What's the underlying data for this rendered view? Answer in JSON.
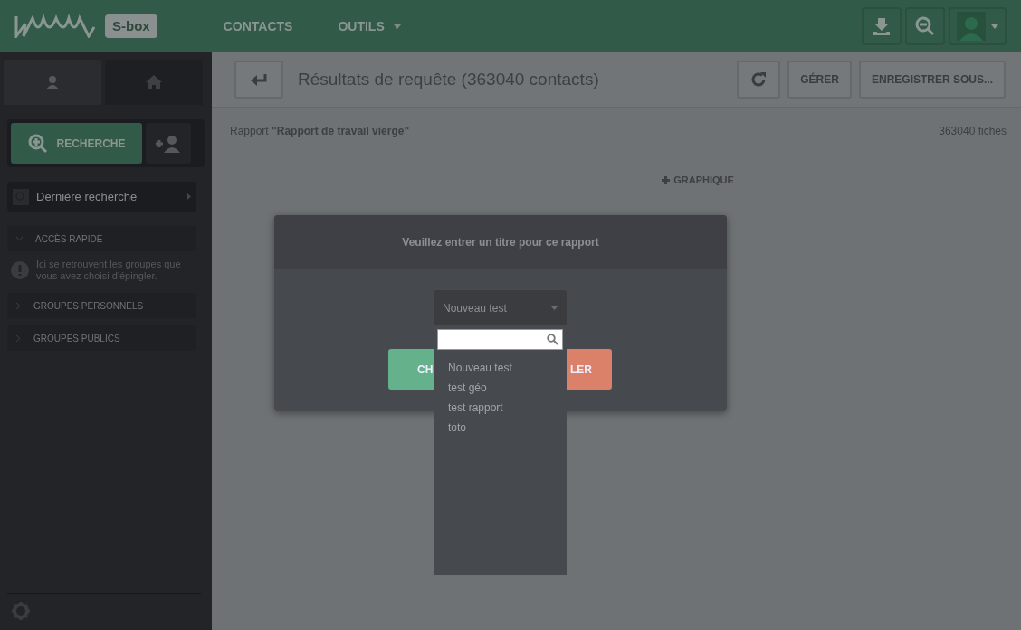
{
  "navbar": {
    "badge": "S-box",
    "items": [
      {
        "label": "CONTACTS",
        "dropdown": false
      },
      {
        "label": "OUTILS",
        "dropdown": true
      }
    ]
  },
  "sidebar": {
    "tabs": [
      {
        "kind": "contacts",
        "selected": true
      },
      {
        "kind": "home",
        "selected": false
      }
    ],
    "search_button": "RECHERCHE",
    "last_search": "Dernière recherche",
    "sections": [
      {
        "label": "ACCÈS RAPIDE",
        "expanded": true,
        "note": "Ici se retrouvent les groupes que vous avez choisi d'épingler."
      },
      {
        "label": "GROUPES PERSONNELS",
        "expanded": false
      },
      {
        "label": "GROUPES PUBLICS",
        "expanded": false
      }
    ]
  },
  "toolbar": {
    "title": "Résultats de requête (363040 contacts)",
    "buttons": [
      "GÉRER",
      "ENREGISTRER SOUS..."
    ]
  },
  "report": {
    "label": "Rapport **\"Rapport de travail vierge\"**",
    "count": "363040 fiches",
    "add_chart": "GRAPHIQUE"
  },
  "modal": {
    "title": "Veuillez entrer un titre pour ce rapport",
    "select_value": "Nouveau test",
    "options": [
      {
        "label": "Nouveau test"
      },
      {
        "label": "test géo"
      },
      {
        "label": "test rapport"
      },
      {
        "label": "toto"
      }
    ],
    "buttons": [
      {
        "kind": "confirm",
        "label": "CH"
      },
      {
        "kind": "cancel",
        "label": "LER"
      }
    ]
  }
}
